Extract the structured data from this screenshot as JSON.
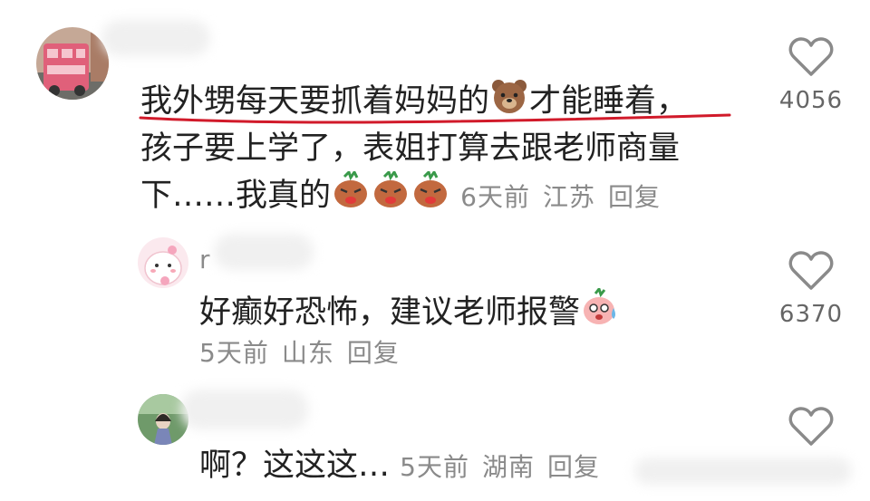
{
  "comments": [
    {
      "text_line1": "我外甥每天要抓着妈妈的",
      "text_line1_end": "才能睡着，",
      "text_line2": "孩子要上学了，表姐打算去跟老师商量",
      "text_line3": "下……我真的",
      "time": "6天前",
      "location": "江苏",
      "reply": "回复",
      "likes": "4056",
      "icons": [
        "bear-emoji",
        "angry-bun-emoji"
      ]
    },
    {
      "username_partial": "r",
      "text": "好癫好恐怖，建议老师报警",
      "time": "5天前",
      "location": "山东",
      "reply": "回复",
      "likes": "6370",
      "icons": [
        "scared-bun-emoji"
      ]
    },
    {
      "text": "啊？这这这…",
      "time": "5天前",
      "location": "湖南",
      "reply": "回复"
    }
  ],
  "colors": {
    "underline": "#d11a2a",
    "meta": "#8a8a8a",
    "heart": "#8a8a8a"
  }
}
